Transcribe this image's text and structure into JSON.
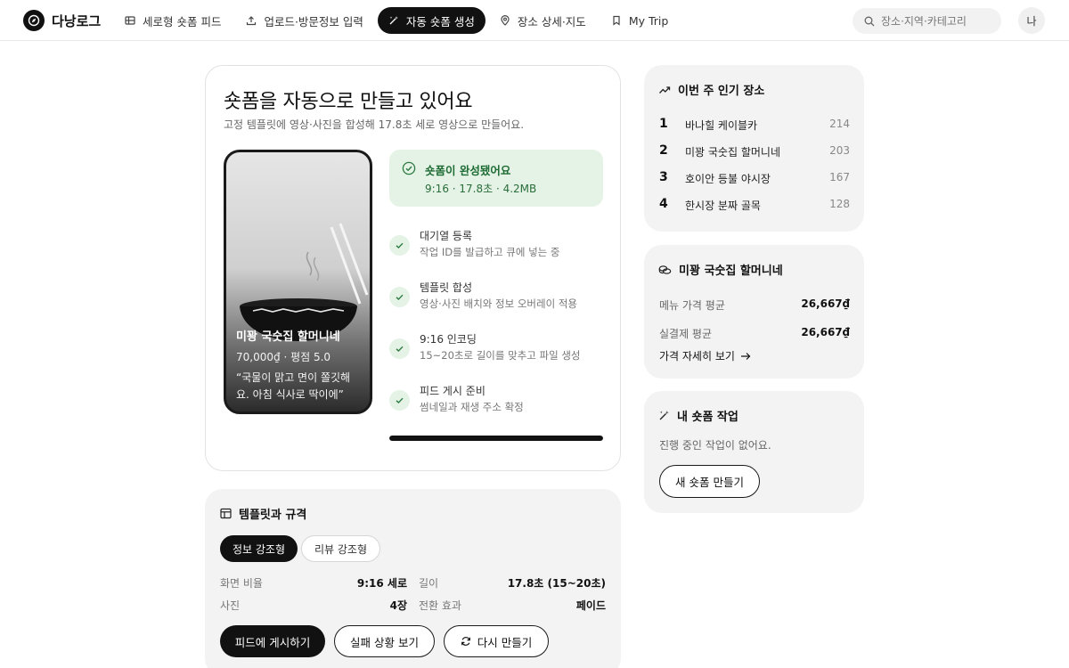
{
  "app": {
    "title": "다낭로그"
  },
  "nav": [
    {
      "label": "세로형 숏폼 피드",
      "icon": "grid-icon",
      "active": false
    },
    {
      "label": "업로드·방문정보 입력",
      "icon": "upload-icon",
      "active": false
    },
    {
      "label": "자동 숏폼 생성",
      "icon": "magic-wand-icon",
      "active": true
    },
    {
      "label": "장소 상세·지도",
      "icon": "map-pin-icon",
      "active": false
    },
    {
      "label": "My Trip",
      "icon": "bookmark-icon",
      "active": false
    }
  ],
  "search": {
    "placeholder": "장소·지역·카테고리"
  },
  "user": {
    "avatar_label": "나"
  },
  "main": {
    "title": "숏폼을 자동으로 만들고 있어요",
    "subtitle": "고정 템플릿에 영상·사진을 합성해 17.8초 세로 영상으로 만들어요.",
    "preview": {
      "place_name": "미꽝 국숫집 할머니네",
      "meta": "70,000₫ · 평점 5.0",
      "quote": "“국물이 맑고 면이 쫄깃해요. 아침 식사로 딱이에”"
    },
    "status": {
      "title": "숏폼이 완성됐어요",
      "meta": "9:16 · 17.8초 · 4.2MB"
    },
    "steps": [
      {
        "title": "대기열 등록",
        "desc": "작업 ID를 발급하고 큐에 넣는 중"
      },
      {
        "title": "템플릿 합성",
        "desc": "영상·사진 배치와 정보 오버레이 적용"
      },
      {
        "title": "9:16 인코딩",
        "desc": "15~20초로 길이를 맞추고 파일 생성"
      },
      {
        "title": "피드 게시 준비",
        "desc": "썸네일과 재생 주소 확정"
      }
    ],
    "progress": 1.0
  },
  "template": {
    "title": "템플릿과 규격",
    "chips": [
      "정보 강조형",
      "리뷰 강조형"
    ],
    "specs": {
      "ratio_label": "화면 비율",
      "ratio_value": "9:16 세로",
      "length_label": "길이",
      "length_value": "17.8초 (15~20초)",
      "photos_label": "사진",
      "photos_value": "4장",
      "transition_label": "전환 효과",
      "transition_value": "페이드"
    },
    "buttons": {
      "post": "피드에 게시하기",
      "failure": "실패 상황 보기",
      "remake": "다시 만들기"
    }
  },
  "popular": {
    "title": "이번 주 인기 장소",
    "items": [
      {
        "rank": "1",
        "name": "바나힐 케이블카",
        "count": "214"
      },
      {
        "rank": "2",
        "name": "미꽝 국숫집 할머니네",
        "count": "203"
      },
      {
        "rank": "3",
        "name": "호이안 등불 야시장",
        "count": "167"
      },
      {
        "rank": "4",
        "name": "한시장 분짜 골목",
        "count": "128"
      }
    ]
  },
  "price": {
    "title": "미꽝 국숫집 할머니네",
    "menu_label": "메뉴 가격 평균",
    "menu_value": "26,667₫",
    "paid_label": "실결제 평균",
    "paid_value": "26,667₫",
    "link": "가격 자세히 보기"
  },
  "jobs": {
    "title": "내 숏폼 작업",
    "empty": "진행 중인 작업이 없어요.",
    "new_button": "새 숏폼 만들기"
  },
  "colors": {
    "accent": "#111111",
    "success_bg": "#e4f3e6",
    "success_text": "#1e6b34",
    "card_bg": "#f3f3f3"
  }
}
